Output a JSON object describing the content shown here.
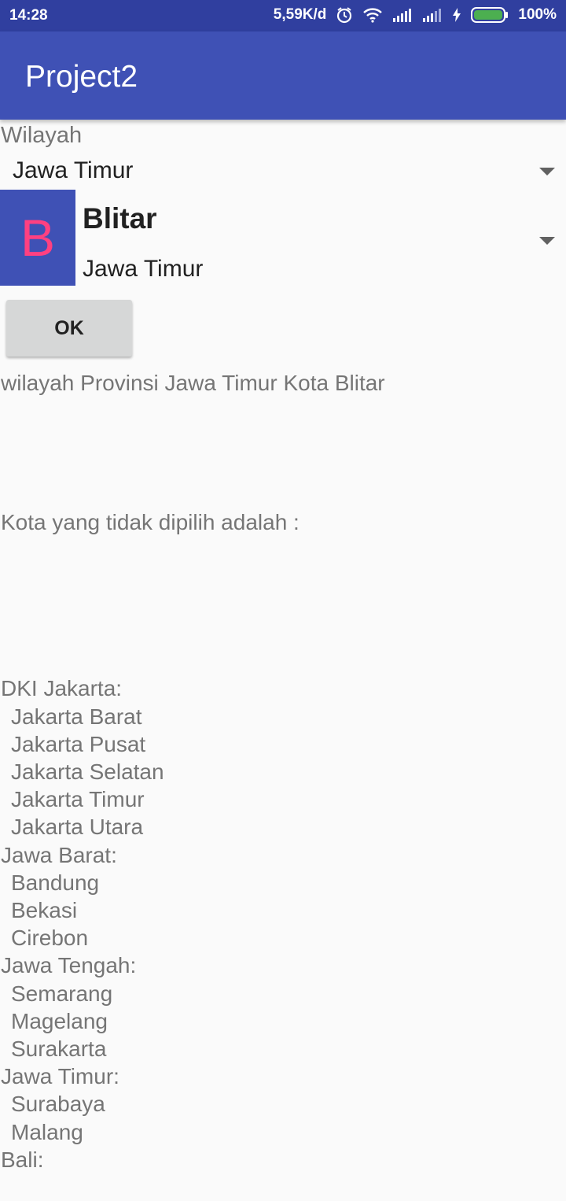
{
  "status_bar": {
    "time": "14:28",
    "network_speed": "5,59K/d",
    "battery": "100%",
    "icons": [
      "alarm-icon",
      "wifi-icon",
      "signal-icon",
      "signal-icon-2",
      "charging-icon",
      "battery-icon"
    ]
  },
  "app_bar": {
    "title": "Project2",
    "color": "#3f51b5"
  },
  "form": {
    "wilayah_label": "Wilayah",
    "province_spinner": {
      "selected": "Jawa Timur"
    },
    "city_spinner": {
      "avatar_letter": "B",
      "city": "Blitar",
      "province": "Jawa Timur"
    },
    "ok_button": "OK"
  },
  "result": {
    "message": "wilayah Provinsi Jawa Timur Kota Blitar",
    "unselected_heading": "Kota yang tidak dipilih adalah :",
    "groups": [
      {
        "province": "DKI Jakarta:",
        "cities": [
          "Jakarta Barat",
          "Jakarta Pusat",
          "Jakarta Selatan",
          "Jakarta Timur",
          "Jakarta Utara"
        ]
      },
      {
        "province": "Jawa Barat:",
        "cities": [
          "Bandung",
          "Bekasi",
          "Cirebon"
        ]
      },
      {
        "province": "Jawa Tengah:",
        "cities": [
          "Semarang",
          "Magelang",
          "Surakarta"
        ]
      },
      {
        "province": "Jawa Timur:",
        "cities": [
          "Surabaya",
          "Malang"
        ]
      },
      {
        "province": "Bali:",
        "cities": []
      }
    ]
  }
}
